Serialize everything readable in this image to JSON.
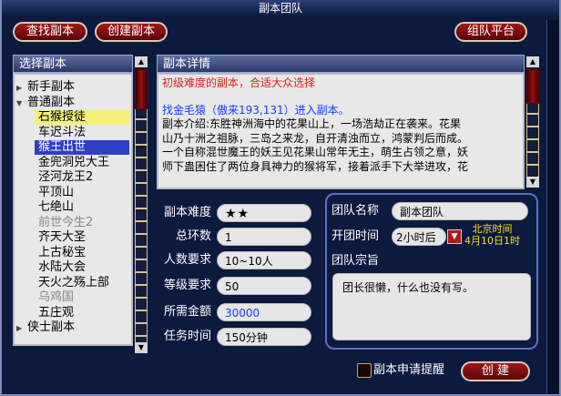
{
  "window": {
    "title": "副本团队"
  },
  "toolbar": {
    "find_label": "查找副本",
    "create_label": "创建副本",
    "platform_label": "组队平台"
  },
  "list": {
    "header": "选择副本",
    "items": [
      {
        "label": "新手副本",
        "type": "group",
        "expanded": false
      },
      {
        "label": "普通副本",
        "type": "group",
        "expanded": true
      },
      {
        "label": "石猴授徒",
        "type": "child",
        "state": "highlight-yellow"
      },
      {
        "label": "车迟斗法",
        "type": "child"
      },
      {
        "label": "猴王出世",
        "type": "child",
        "state": "selected"
      },
      {
        "label": "金兜洞兕大王",
        "type": "child"
      },
      {
        "label": "泾河龙王2",
        "type": "child"
      },
      {
        "label": "平顶山",
        "type": "child"
      },
      {
        "label": "七绝山",
        "type": "child"
      },
      {
        "label": "前世今生2",
        "type": "child",
        "state": "disabled"
      },
      {
        "label": "齐天大圣",
        "type": "child"
      },
      {
        "label": "上古秘宝",
        "type": "child"
      },
      {
        "label": "水陆大会",
        "type": "child"
      },
      {
        "label": "天火之殇上部",
        "type": "child"
      },
      {
        "label": "乌鸡国",
        "type": "child",
        "state": "disabled"
      },
      {
        "label": "五庄观",
        "type": "child"
      },
      {
        "label": "侠士副本",
        "type": "group",
        "expanded": false
      }
    ]
  },
  "detail": {
    "header": "副本详情",
    "difficulty_note": "初级难度的副本，合适大众选择",
    "find_link": "找金毛猿（傲来193,131）进入副本。",
    "intro_lines": [
      "副本介绍:东胜神洲海中的花果山上，一场浩劫正在袭来。花果",
      "山乃十洲之祖脉，三岛之来龙，自开清浊而立，鸿蒙判后而成。",
      "一个自称混世魔王的妖王见花果山常年无主，萌生占领之意，妖",
      "师下蛊困住了两位身具神力的猴将军，接着派手下大举进攻，花"
    ]
  },
  "stats": {
    "difficulty_label": "副本难度",
    "difficulty_stars": "★★",
    "rounds_label": "总环数",
    "rounds_value": "1",
    "players_label": "人数要求",
    "players_value": "10~10人",
    "level_label": "等级要求",
    "level_value": "50",
    "gold_label": "所需金额",
    "gold_value": "30000",
    "time_label": "任务时间",
    "time_value": "150分钟"
  },
  "team": {
    "name_label": "团队名称",
    "name_value": "副本团队",
    "open_label": "开团时间",
    "open_value": "2小时后",
    "beijing_label": "北京时间",
    "beijing_date": "4月10日1时",
    "motto_label": "团队宗旨",
    "motto_value": "团长很懒，什么也没有写。"
  },
  "footer": {
    "remind_label": "副本申请提醒",
    "remind_checked": false,
    "create_label": "创 建"
  },
  "colors": {
    "bg": "#0c1a3e",
    "button_red": "#a01818",
    "selected_blue": "#2f3fc4",
    "highlight_yellow": "#f3f07a",
    "note_red": "#e02020",
    "link_blue": "#1a3cff",
    "gold_blue": "#1a3cff",
    "beijing_yellow": "#f4e028"
  }
}
